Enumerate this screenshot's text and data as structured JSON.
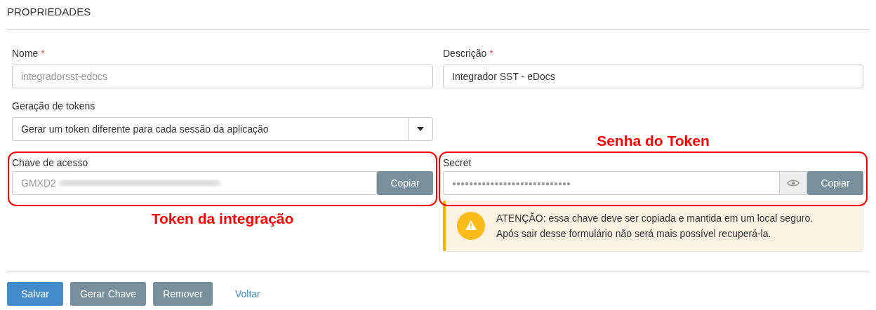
{
  "section_title": "PROPRIEDADES",
  "nome": {
    "label": "Nome",
    "required_mark": "*",
    "value": "integradorsst-edocs",
    "disabled": true
  },
  "descricao": {
    "label": "Descrição",
    "required_mark": "*",
    "value": "Integrador SST - eDocs",
    "disabled": false
  },
  "geracao_tokens": {
    "label": "Geração de tokens",
    "value": "Gerar um token diferente para cada sessão da aplicação"
  },
  "chave_acesso": {
    "label": "Chave de acesso",
    "value": "GMXD2",
    "copy_button": "Copiar"
  },
  "secret": {
    "label": "Secret",
    "value": "●●●●●●●●●●●●●●●●●●●●●●●●●●●●",
    "copy_button": "Copiar"
  },
  "alert": {
    "lines": [
      "ATENÇÃO: essa chave deve ser copiada e mantida em um local seguro.",
      "Após sair desse formulário não será mais possível recuperá-la."
    ]
  },
  "annotations": [
    {
      "text": "Senha do Token"
    },
    {
      "text": "Token da integração"
    }
  ],
  "buttons": [
    {
      "label": "Salvar",
      "kind": "primary"
    },
    {
      "label": "Gerar Chave",
      "kind": "secondary"
    },
    {
      "label": "Remover",
      "kind": "secondary"
    },
    {
      "label": "Voltar",
      "kind": "link"
    }
  ]
}
